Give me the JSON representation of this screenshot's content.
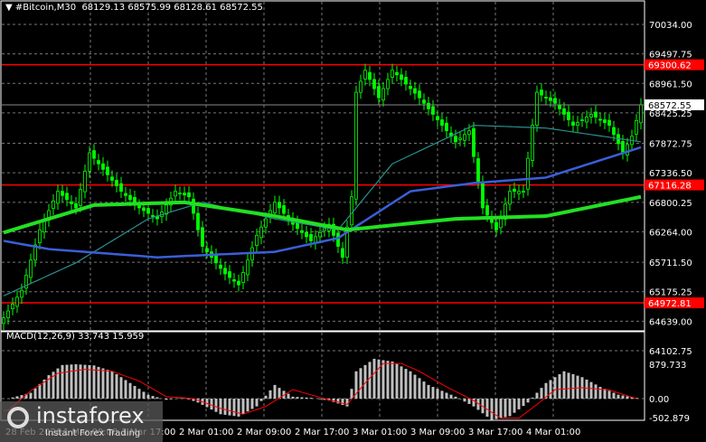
{
  "header": {
    "symbol": "#Bitcoin,M30",
    "ohlc": "68129.13 68575.99 68128.61 68572.55"
  },
  "macd": {
    "label": "MACD(12,26,9) 33.743 15.959"
  },
  "logo": {
    "name": "instaforex",
    "slogan": "Instant Forex Trading"
  },
  "colors": {
    "bg": "#000000",
    "candle": "#00ff00",
    "ma_green": "#22e022",
    "ma_blue": "#3a5fd8",
    "ma_teal": "#2a8f8f",
    "level": "#ff0000",
    "hist": "#c0c0c0",
    "signal": "#ff0000"
  },
  "chart_data": {
    "type": "candlestick",
    "title": "#Bitcoin,M30",
    "y_ticks": [
      70034.0,
      69497.75,
      68961.5,
      68425.25,
      67872.75,
      67336.5,
      66800.25,
      66264.0,
      65711.5,
      65175.25,
      64639.0,
      64102.75
    ],
    "ylim": [
      64102.75,
      70034.0
    ],
    "current_price": "68572.55",
    "levels": [
      "69300.62",
      "67116.28",
      "64972.81"
    ],
    "x_ticks": [
      "28 Feb 2026",
      "1 Mar 09:00",
      "1 Mar 17:00",
      "2 Mar 01:00",
      "2 Mar 09:00",
      "2 Mar 17:00",
      "3 Mar 01:00",
      "3 Mar 09:00",
      "3 Mar 17:00",
      "4 Mar 01:00"
    ],
    "close_keypoints": [
      [
        0,
        64700
      ],
      [
        4,
        65200
      ],
      [
        8,
        66300
      ],
      [
        12,
        67000
      ],
      [
        16,
        66700
      ],
      [
        19,
        67700
      ],
      [
        22,
        67400
      ],
      [
        26,
        67000
      ],
      [
        30,
        66700
      ],
      [
        34,
        66500
      ],
      [
        38,
        67000
      ],
      [
        41,
        66900
      ],
      [
        44,
        66000
      ],
      [
        49,
        65500
      ],
      [
        52,
        65300
      ],
      [
        56,
        66200
      ],
      [
        60,
        66800
      ],
      [
        64,
        66400
      ],
      [
        68,
        66100
      ],
      [
        72,
        66400
      ],
      [
        75,
        65800
      ],
      [
        77,
        66900
      ],
      [
        78,
        68800
      ],
      [
        80,
        69200
      ],
      [
        83,
        68700
      ],
      [
        86,
        69200
      ],
      [
        92,
        68700
      ],
      [
        96,
        68300
      ],
      [
        100,
        67900
      ],
      [
        103,
        68100
      ],
      [
        106,
        66700
      ],
      [
        109,
        66300
      ],
      [
        112,
        67000
      ],
      [
        115,
        67000
      ],
      [
        118,
        68800
      ],
      [
        122,
        68600
      ],
      [
        126,
        68200
      ],
      [
        130,
        68400
      ],
      [
        134,
        68200
      ],
      [
        137,
        67700
      ],
      [
        139,
        68000
      ],
      [
        141,
        68572.55
      ]
    ],
    "ma_green": [
      [
        0,
        66250
      ],
      [
        20,
        66750
      ],
      [
        40,
        66800
      ],
      [
        60,
        66550
      ],
      [
        76,
        66300
      ],
      [
        100,
        66500
      ],
      [
        120,
        66550
      ],
      [
        141,
        66900
      ]
    ],
    "ma_blue": [
      [
        0,
        66100
      ],
      [
        10,
        65950
      ],
      [
        34,
        65800
      ],
      [
        60,
        65900
      ],
      [
        74,
        66150
      ],
      [
        90,
        67000
      ],
      [
        104,
        67150
      ],
      [
        120,
        67250
      ],
      [
        141,
        67800
      ]
    ],
    "ma_teal": [
      [
        0,
        65100
      ],
      [
        16,
        65700
      ],
      [
        32,
        66500
      ],
      [
        44,
        66800
      ],
      [
        60,
        66500
      ],
      [
        74,
        66300
      ],
      [
        86,
        67500
      ],
      [
        104,
        68200
      ],
      [
        120,
        68150
      ],
      [
        141,
        67900
      ]
    ],
    "macd_ticks": [
      "879.733",
      "0.00",
      "-502.879"
    ],
    "macd_range": [
      -502.879,
      879.733
    ],
    "macd_hist": [
      [
        1,
        0
      ],
      [
        6,
        150
      ],
      [
        10,
        600
      ],
      [
        13,
        860
      ],
      [
        16,
        880
      ],
      [
        20,
        850
      ],
      [
        24,
        700
      ],
      [
        28,
        400
      ],
      [
        32,
        100
      ],
      [
        36,
        -30
      ],
      [
        40,
        20
      ],
      [
        43,
        -100
      ],
      [
        48,
        -400
      ],
      [
        52,
        -460
      ],
      [
        56,
        -200
      ],
      [
        60,
        350
      ],
      [
        64,
        50
      ],
      [
        68,
        20
      ],
      [
        72,
        -50
      ],
      [
        76,
        -200
      ],
      [
        78,
        700
      ],
      [
        82,
        1020
      ],
      [
        86,
        950
      ],
      [
        90,
        700
      ],
      [
        94,
        350
      ],
      [
        100,
        50
      ],
      [
        104,
        -200
      ],
      [
        108,
        -550
      ],
      [
        112,
        -450
      ],
      [
        116,
        -100
      ],
      [
        120,
        400
      ],
      [
        124,
        700
      ],
      [
        128,
        550
      ],
      [
        132,
        300
      ],
      [
        136,
        100
      ],
      [
        140,
        20
      ]
    ],
    "macd_signal": [
      [
        1,
        -300
      ],
      [
        6,
        200
      ],
      [
        12,
        650
      ],
      [
        18,
        750
      ],
      [
        24,
        700
      ],
      [
        30,
        450
      ],
      [
        36,
        50
      ],
      [
        42,
        0
      ],
      [
        48,
        -250
      ],
      [
        53,
        -400
      ],
      [
        58,
        -200
      ],
      [
        64,
        230
      ],
      [
        70,
        30
      ],
      [
        76,
        -150
      ],
      [
        80,
        400
      ],
      [
        84,
        900
      ],
      [
        88,
        900
      ],
      [
        92,
        700
      ],
      [
        98,
        300
      ],
      [
        104,
        -50
      ],
      [
        110,
        -500
      ],
      [
        114,
        -500
      ],
      [
        118,
        -150
      ],
      [
        122,
        230
      ],
      [
        128,
        280
      ],
      [
        134,
        220
      ],
      [
        140,
        0
      ]
    ]
  }
}
